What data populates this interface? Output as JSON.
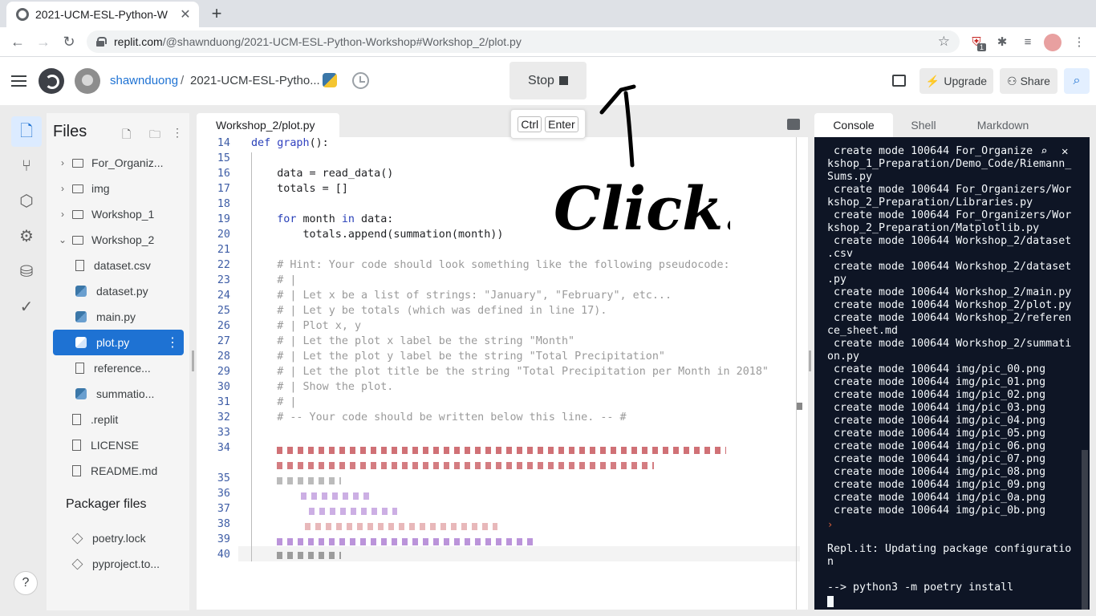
{
  "browser": {
    "tab_title": "2021-UCM-ESL-Python-W",
    "url_host": "replit.com",
    "url_path": "/@shawnduong/2021-UCM-ESL-Python-Workshop#Workshop_2/plot.py",
    "ext_badge": "1"
  },
  "header": {
    "user": "shawnduong",
    "separator": "/",
    "repl_name": "2021-UCM-ESL-Pytho...",
    "stop_label": "Stop",
    "upgrade_label": "Upgrade",
    "share_label": "Share",
    "shortcut_keys": [
      "Ctrl",
      "Enter"
    ]
  },
  "files": {
    "title": "Files",
    "items": [
      {
        "label": "For_Organiz...",
        "kind": "folder",
        "chevron": "›"
      },
      {
        "label": "img",
        "kind": "folder",
        "chevron": "›"
      },
      {
        "label": "Workshop_1",
        "kind": "folder",
        "chevron": "›"
      },
      {
        "label": "Workshop_2",
        "kind": "folder",
        "chevron": "⌄"
      },
      {
        "label": "dataset.csv",
        "kind": "doc"
      },
      {
        "label": "dataset.py",
        "kind": "py"
      },
      {
        "label": "main.py",
        "kind": "py"
      },
      {
        "label": "plot.py",
        "kind": "py"
      },
      {
        "label": "reference...",
        "kind": "doc"
      },
      {
        "label": "summatio...",
        "kind": "py"
      },
      {
        "label": ".replit",
        "kind": "doc"
      },
      {
        "label": "LICENSE",
        "kind": "doc"
      },
      {
        "label": "README.md",
        "kind": "doc"
      }
    ],
    "packager_title": "Packager files",
    "packager_items": [
      "poetry.lock",
      "pyproject.to..."
    ]
  },
  "editor": {
    "tab": "Workshop_2/plot.py",
    "lines": [
      {
        "n": "14",
        "text": "def graph():"
      },
      {
        "n": "15",
        "text": ""
      },
      {
        "n": "16",
        "text": "    data = read_data()"
      },
      {
        "n": "17",
        "text": "    totals = []"
      },
      {
        "n": "18",
        "text": ""
      },
      {
        "n": "19",
        "text": "    for month in data:"
      },
      {
        "n": "20",
        "text": "        totals.append(summation(month))"
      },
      {
        "n": "21",
        "text": ""
      },
      {
        "n": "22",
        "text": "    # Hint: Your code should look something like the following pseudocode:"
      },
      {
        "n": "23",
        "text": "    # |"
      },
      {
        "n": "24",
        "text": "    # | Let x be a list of strings: \"January\", \"February\", etc..."
      },
      {
        "n": "25",
        "text": "    # | Let y be totals (which was defined in line 17)."
      },
      {
        "n": "26",
        "text": "    # | Plot x, y"
      },
      {
        "n": "27",
        "text": "    # | Let the plot x label be the string \"Month\""
      },
      {
        "n": "28",
        "text": "    # | Let the plot y label be the string \"Total Precipitation\""
      },
      {
        "n": "29",
        "text": "    # | Let the plot title be the string \"Total Precipitation per Month in 2018\""
      },
      {
        "n": "30",
        "text": "    # | Show the plot."
      },
      {
        "n": "31",
        "text": "    # |"
      },
      {
        "n": "32",
        "text": "    # -- Your code should be written below this line. -- #"
      },
      {
        "n": "33",
        "text": ""
      },
      {
        "n": "34",
        "text": ""
      },
      {
        "n": "35",
        "text": ""
      },
      {
        "n": "36",
        "text": ""
      },
      {
        "n": "37",
        "text": ""
      },
      {
        "n": "38",
        "text": ""
      },
      {
        "n": "39",
        "text": ""
      },
      {
        "n": "40",
        "text": ""
      }
    ]
  },
  "right_panel": {
    "tabs": [
      "Console",
      "Shell",
      "Markdown"
    ],
    "console_lines": [
      " create mode 100644 For_Organize",
      "kshop_1_Preparation/Demo_Code/Riemann_",
      "Sums.py",
      " create mode 100644 For_Organizers/Wor",
      "kshop_2_Preparation/Libraries.py",
      " create mode 100644 For_Organizers/Wor",
      "kshop_2_Preparation/Matplotlib.py",
      " create mode 100644 Workshop_2/dataset",
      ".csv",
      " create mode 100644 Workshop_2/dataset",
      ".py",
      " create mode 100644 Workshop_2/main.py",
      " create mode 100644 Workshop_2/plot.py",
      " create mode 100644 Workshop_2/referen",
      "ce_sheet.md",
      " create mode 100644 Workshop_2/summati",
      "on.py",
      " create mode 100644 img/pic_00.png",
      " create mode 100644 img/pic_01.png",
      " create mode 100644 img/pic_02.png",
      " create mode 100644 img/pic_03.png",
      " create mode 100644 img/pic_04.png",
      " create mode 100644 img/pic_05.png",
      " create mode 100644 img/pic_06.png",
      " create mode 100644 img/pic_07.png",
      " create mode 100644 img/pic_08.png",
      " create mode 100644 img/pic_09.png",
      " create mode 100644 img/pic_0a.png",
      " create mode 100644 img/pic_0b.png"
    ],
    "prompt_glyph": "›",
    "status_1": "Repl.it: Updating package configuratio",
    "status_2": "n",
    "command": "--> python3 -m poetry install"
  },
  "annotation": {
    "text": "Click!",
    "color": "#000000"
  },
  "colors": {
    "accent": "#1e72d3",
    "console_bg": "#0e1525",
    "workspace_bg": "#ebebeb"
  }
}
